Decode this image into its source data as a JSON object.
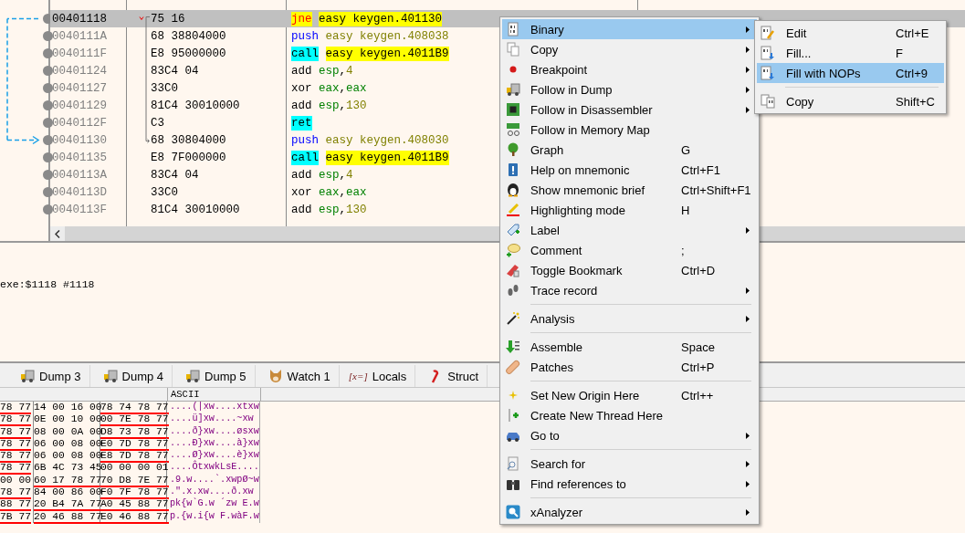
{
  "disassembly": {
    "rows": [
      {
        "address": "00401118",
        "bytes": "75 16",
        "mnemonic": {
          "text": "jne",
          "kind": "jump"
        },
        "operands": [
          {
            "text": "easy keygen.401130",
            "kind": "target"
          }
        ],
        "selected": true,
        "jump_source": true,
        "jump_target": false
      },
      {
        "address": "0040111A",
        "bytes": "68 38804000",
        "mnemonic": {
          "text": "push",
          "kind": "push"
        },
        "operands": [
          {
            "text": "easy keygen.408038",
            "kind": "address"
          }
        ],
        "selected": false,
        "jump_source": false,
        "jump_target": false
      },
      {
        "address": "0040111F",
        "bytes": "E8 95000000",
        "mnemonic": {
          "text": "call",
          "kind": "call"
        },
        "operands": [
          {
            "text": "easy keygen.4011B9",
            "kind": "target"
          }
        ],
        "selected": false,
        "jump_source": false,
        "jump_target": false
      },
      {
        "address": "00401124",
        "bytes": "83C4 04",
        "mnemonic": {
          "text": "add",
          "kind": "plain"
        },
        "operands": [
          {
            "text": "esp",
            "kind": "register"
          },
          {
            "text": ",",
            "kind": "punct"
          },
          {
            "text": "4",
            "kind": "number"
          }
        ],
        "selected": false,
        "jump_source": false,
        "jump_target": false
      },
      {
        "address": "00401127",
        "bytes": "33C0",
        "mnemonic": {
          "text": "xor",
          "kind": "plain"
        },
        "operands": [
          {
            "text": "eax",
            "kind": "register"
          },
          {
            "text": ",",
            "kind": "punct"
          },
          {
            "text": "eax",
            "kind": "register"
          }
        ],
        "selected": false,
        "jump_source": false,
        "jump_target": false
      },
      {
        "address": "00401129",
        "bytes": "81C4 30010000",
        "mnemonic": {
          "text": "add",
          "kind": "plain"
        },
        "operands": [
          {
            "text": "esp",
            "kind": "register"
          },
          {
            "text": ",",
            "kind": "punct"
          },
          {
            "text": "130",
            "kind": "number"
          }
        ],
        "selected": false,
        "jump_source": false,
        "jump_target": false
      },
      {
        "address": "0040112F",
        "bytes": "C3",
        "mnemonic": {
          "text": "ret",
          "kind": "ret"
        },
        "operands": [],
        "selected": false,
        "jump_source": false,
        "jump_target": false
      },
      {
        "address": "00401130",
        "bytes": "68 30804000",
        "mnemonic": {
          "text": "push",
          "kind": "push"
        },
        "operands": [
          {
            "text": "easy keygen.408030",
            "kind": "address"
          }
        ],
        "selected": false,
        "jump_source": false,
        "jump_target": true
      },
      {
        "address": "00401135",
        "bytes": "E8 7F000000",
        "mnemonic": {
          "text": "call",
          "kind": "call"
        },
        "operands": [
          {
            "text": "easy keygen.4011B9",
            "kind": "target"
          }
        ],
        "selected": false,
        "jump_source": false,
        "jump_target": false
      },
      {
        "address": "0040113A",
        "bytes": "83C4 04",
        "mnemonic": {
          "text": "add",
          "kind": "plain"
        },
        "operands": [
          {
            "text": "esp",
            "kind": "register"
          },
          {
            "text": ",",
            "kind": "punct"
          },
          {
            "text": "4",
            "kind": "number"
          }
        ],
        "selected": false,
        "jump_source": false,
        "jump_target": false
      },
      {
        "address": "0040113D",
        "bytes": "33C0",
        "mnemonic": {
          "text": "xor",
          "kind": "plain"
        },
        "operands": [
          {
            "text": "eax",
            "kind": "register"
          },
          {
            "text": ",",
            "kind": "punct"
          },
          {
            "text": "eax",
            "kind": "register"
          }
        ],
        "selected": false,
        "jump_source": false,
        "jump_target": false
      },
      {
        "address": "0040113F",
        "bytes": "81C4 30010000",
        "mnemonic": {
          "text": "add",
          "kind": "plain"
        },
        "operands": [
          {
            "text": "esp",
            "kind": "register"
          },
          {
            "text": ",",
            "kind": "punct"
          },
          {
            "text": "130",
            "kind": "number"
          }
        ],
        "selected": false,
        "jump_source": false,
        "jump_target": false
      }
    ]
  },
  "info": {
    "text": "exe:$1118 #1118"
  },
  "tabs": [
    {
      "label": "Dump 3",
      "selected": false
    },
    {
      "label": "Dump 4",
      "selected": false
    },
    {
      "label": "Dump 5",
      "selected": false
    },
    {
      "label": "Watch 1",
      "selected": false
    },
    {
      "label": "Locals",
      "icon_text": "[x=]",
      "selected": false
    },
    {
      "label": "Struct",
      "selected": false
    }
  ],
  "dump": {
    "ascii_header": "ASCII",
    "rows": [
      {
        "cells": [
          {
            "text": "78 77",
            "underlined": true
          },
          {
            "text": "14 00 16 00",
            "underlined": false
          },
          {
            "text": "78 74 78 77",
            "underlined": true
          }
        ],
        "ascii": "....(|xw....xtxw"
      },
      {
        "cells": [
          {
            "text": "78 77",
            "underlined": true
          },
          {
            "text": "0E 00 10 00",
            "underlined": false
          },
          {
            "text": "00 7E 78 77",
            "underlined": true
          }
        ],
        "ascii": "....ü]xw....~xw"
      },
      {
        "cells": [
          {
            "text": "78 77",
            "underlined": true
          },
          {
            "text": "08 00 0A 00",
            "underlined": false
          },
          {
            "text": "D8 73 78 77",
            "underlined": true
          }
        ],
        "ascii": "....ð}xw....øsxw"
      },
      {
        "cells": [
          {
            "text": "78 77",
            "underlined": true
          },
          {
            "text": "06 00 08 00",
            "underlined": false
          },
          {
            "text": "E0 7D 78 77",
            "underlined": true
          }
        ],
        "ascii": "....Ð}xw....à}xw"
      },
      {
        "cells": [
          {
            "text": "78 77",
            "underlined": true
          },
          {
            "text": "06 00 08 00",
            "underlined": false
          },
          {
            "text": "E8 7D 78 77",
            "underlined": true
          }
        ],
        "ascii": "....Ø}xw....è}xw"
      },
      {
        "cells": [
          {
            "text": "78 77",
            "underlined": true
          },
          {
            "text": "6B 4C 73 45",
            "underlined": false
          },
          {
            "text": "00 00 00 01",
            "underlined": false
          }
        ],
        "ascii": "....ÔtxwkLsE...."
      },
      {
        "cells": [
          {
            "text": "00 00",
            "underlined": false
          },
          {
            "text": "60 17 78 77",
            "underlined": true
          },
          {
            "text": "70 D8 7E 77",
            "underlined": true
          }
        ],
        "ascii": ".9.w....`.xwpØ~w"
      },
      {
        "cells": [
          {
            "text": "78 77",
            "underlined": true
          },
          {
            "text": "84 00 86 00",
            "underlined": false
          },
          {
            "text": "F0 7F 78 77",
            "underlined": true
          }
        ],
        "ascii": ".\".x.xw....ð.xw"
      },
      {
        "cells": [
          {
            "text": "88 77",
            "underlined": true
          },
          {
            "text": "20 B4 7A 77",
            "underlined": true
          },
          {
            "text": "A0 45 88 77",
            "underlined": true
          }
        ],
        "ascii": "pk{w`G.w ´zw E.w"
      },
      {
        "cells": [
          {
            "text": "7B 77",
            "underlined": true
          },
          {
            "text": "20 46 88 77",
            "underlined": true
          },
          {
            "text": "E0 46 88 77",
            "underlined": true
          }
        ],
        "ascii": "p.{w.i{w F.wàF.w"
      }
    ]
  },
  "context_menu": {
    "items": [
      {
        "kind": "item",
        "label": "Binary",
        "submenu": true,
        "selected": true
      },
      {
        "kind": "item",
        "label": "Copy",
        "submenu": true,
        "selected": false
      },
      {
        "kind": "item",
        "label": "Breakpoint",
        "submenu": true,
        "selected": false
      },
      {
        "kind": "item",
        "label": "Follow in Dump",
        "submenu": true,
        "selected": false
      },
      {
        "kind": "item",
        "label": "Follow in Disassembler",
        "submenu": true,
        "selected": false
      },
      {
        "kind": "item",
        "label": "Follow in Memory Map",
        "submenu": false,
        "selected": false
      },
      {
        "kind": "item",
        "label": "Graph",
        "shortcut": "G",
        "submenu": false,
        "selected": false
      },
      {
        "kind": "item",
        "label": "Help on mnemonic",
        "shortcut": "Ctrl+F1",
        "submenu": false,
        "selected": false
      },
      {
        "kind": "item",
        "label": "Show mnemonic brief",
        "shortcut": "Ctrl+Shift+F1",
        "submenu": false,
        "selected": false
      },
      {
        "kind": "item",
        "label": "Highlighting mode",
        "shortcut": "H",
        "submenu": false,
        "selected": false
      },
      {
        "kind": "item",
        "label": "Label",
        "submenu": true,
        "selected": false
      },
      {
        "kind": "item",
        "label": "Comment",
        "shortcut": ";",
        "submenu": false,
        "selected": false
      },
      {
        "kind": "item",
        "label": "Toggle Bookmark",
        "shortcut": "Ctrl+D",
        "submenu": false,
        "selected": false
      },
      {
        "kind": "item",
        "label": "Trace record",
        "submenu": true,
        "selected": false
      },
      {
        "kind": "separator"
      },
      {
        "kind": "item",
        "label": "Analysis",
        "submenu": true,
        "selected": false
      },
      {
        "kind": "separator"
      },
      {
        "kind": "item",
        "label": "Assemble",
        "shortcut": "Space",
        "submenu": false,
        "selected": false
      },
      {
        "kind": "item",
        "label": "Patches",
        "shortcut": "Ctrl+P",
        "submenu": false,
        "selected": false
      },
      {
        "kind": "separator"
      },
      {
        "kind": "item",
        "label": "Set New Origin Here",
        "shortcut": "Ctrl++",
        "submenu": false,
        "selected": false
      },
      {
        "kind": "item",
        "label": "Create New Thread Here",
        "submenu": false,
        "selected": false
      },
      {
        "kind": "item",
        "label": "Go to",
        "submenu": true,
        "selected": false
      },
      {
        "kind": "separator"
      },
      {
        "kind": "item",
        "label": "Search for",
        "submenu": true,
        "selected": false
      },
      {
        "kind": "item",
        "label": "Find references to",
        "submenu": true,
        "selected": false
      },
      {
        "kind": "separator"
      },
      {
        "kind": "item",
        "label": "xAnalyzer",
        "submenu": true,
        "selected": false
      }
    ]
  },
  "submenu": {
    "items": [
      {
        "kind": "item",
        "label": "Edit",
        "shortcut": "Ctrl+E",
        "selected": false
      },
      {
        "kind": "item",
        "label": "Fill...",
        "shortcut": "F",
        "selected": false
      },
      {
        "kind": "item",
        "label": "Fill with NOPs",
        "shortcut": "Ctrl+9",
        "selected": true
      },
      {
        "kind": "separator"
      },
      {
        "kind": "item",
        "label": "Copy",
        "shortcut": "Shift+C",
        "selected": false
      }
    ]
  }
}
